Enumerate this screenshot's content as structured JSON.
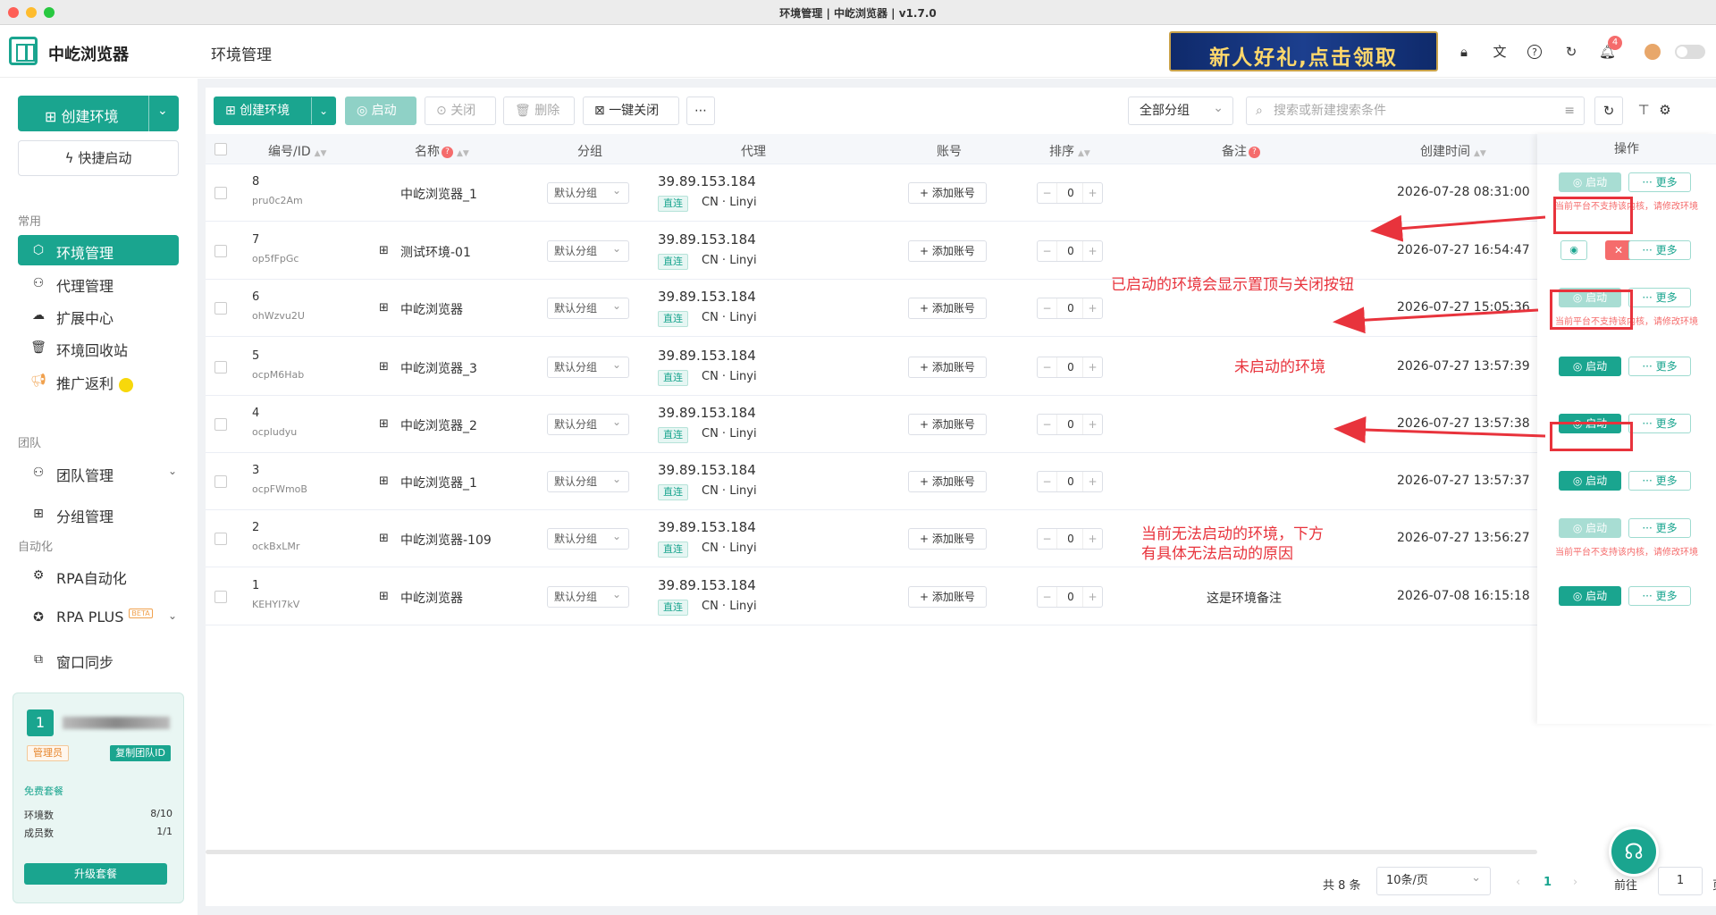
{
  "window": {
    "title": "环境管理 | 中屹浏览器 | v1.7.0"
  },
  "brand": {
    "name": "中屹浏览器",
    "accent": "#1aa58f"
  },
  "header": {
    "page_title": "环境管理",
    "banner": "新人好礼,点击领取",
    "notif_count": "4"
  },
  "sidebar": {
    "create": "创建环境",
    "quick": "快捷启动",
    "sections": {
      "common": "常用",
      "team": "团队",
      "auto": "自动化"
    },
    "items": [
      "环境管理",
      "代理管理",
      "扩展中心",
      "环境回收站",
      "推广返利",
      "团队管理",
      "分组管理",
      "RPA自动化",
      "RPA PLUS",
      "窗口同步"
    ],
    "beta": "BETA",
    "team": {
      "num": "1",
      "role": "管理员",
      "copy": "复制团队ID",
      "plan": "免费套餐",
      "env_label": "环境数",
      "env_val": "8/10",
      "member_label": "成员数",
      "member_val": "1/1",
      "upgrade": "升级套餐"
    }
  },
  "toolbar": {
    "create": "创建环境",
    "start": "启动",
    "close": "关闭",
    "delete": "删除",
    "one_close": "一键关闭",
    "group": "全部分组",
    "search_placeholder": "搜索或新建搜索条件"
  },
  "table": {
    "headers": {
      "id": "编号/ID",
      "name": "名称",
      "group": "分组",
      "proxy": "代理",
      "account": "账号",
      "sort": "排序",
      "note": "备注",
      "created": "创建时间",
      "ops": "操作"
    },
    "labels": {
      "add_account": "添加账号",
      "direct": "直连",
      "start": "启动",
      "more": "更多",
      "warn": "当前平台不支持该内核，请修改环境"
    },
    "rows": [
      {
        "num": "8",
        "code": "pru0c2Am",
        "os": "apple",
        "name": "中屹浏览器_1",
        "group": "默认分组",
        "ip": "39.89.153.184",
        "loc": "CN · Linyi",
        "sort": "0",
        "note": "",
        "created": "2026-07-28 08:31:00",
        "state": "unsupported"
      },
      {
        "num": "7",
        "code": "op5fFpGc",
        "os": "windows",
        "name": "测试环境-01",
        "group": "默认分组",
        "ip": "39.89.153.184",
        "loc": "CN · Linyi",
        "sort": "0",
        "note": "",
        "created": "2026-07-27 16:54:47",
        "state": "running"
      },
      {
        "num": "6",
        "code": "ohWzvu2U",
        "os": "windows",
        "name": "中屹浏览器",
        "group": "默认分组",
        "ip": "39.89.153.184",
        "loc": "CN · Linyi",
        "sort": "0",
        "note": "",
        "created": "2026-07-27 15:05:36",
        "state": "unsupported"
      },
      {
        "num": "5",
        "code": "ocpM6Hab",
        "os": "windows",
        "name": "中屹浏览器_3",
        "group": "默认分组",
        "ip": "39.89.153.184",
        "loc": "CN · Linyi",
        "sort": "0",
        "note": "",
        "created": "2026-07-27 13:57:39",
        "state": "stopped"
      },
      {
        "num": "4",
        "code": "ocpludyu",
        "os": "windows",
        "name": "中屹浏览器_2",
        "group": "默认分组",
        "ip": "39.89.153.184",
        "loc": "CN · Linyi",
        "sort": "0",
        "note": "",
        "created": "2026-07-27 13:57:38",
        "state": "stopped"
      },
      {
        "num": "3",
        "code": "ocpFWmoB",
        "os": "windows",
        "name": "中屹浏览器_1",
        "group": "默认分组",
        "ip": "39.89.153.184",
        "loc": "CN · Linyi",
        "sort": "0",
        "note": "",
        "created": "2026-07-27 13:57:37",
        "state": "stopped"
      },
      {
        "num": "2",
        "code": "ockBxLMr",
        "os": "windows",
        "name": "中屹浏览器-109",
        "group": "默认分组",
        "ip": "39.89.153.184",
        "loc": "CN · Linyi",
        "sort": "0",
        "note": "",
        "created": "2026-07-27 13:56:27",
        "state": "unsupported"
      },
      {
        "num": "1",
        "code": "KEHYI7kV",
        "os": "windows",
        "name": "中屹浏览器",
        "group": "默认分组",
        "ip": "39.89.153.184",
        "loc": "CN · Linyi",
        "sort": "0",
        "note": "这是环境备注",
        "created": "2026-07-08 16:15:18",
        "state": "stopped"
      }
    ]
  },
  "annotations": {
    "running": "已启动的环境会显示置顶与关闭按钮",
    "stopped": "未启动的环境",
    "unsupported_1": "当前无法启动的环境，下方",
    "unsupported_2": "有具体无法启动的原因"
  },
  "pagination": {
    "total": "共 8 条",
    "size": "10条/页",
    "current": "1",
    "goto": "前往",
    "page_input": "1",
    "page_unit": "页"
  }
}
